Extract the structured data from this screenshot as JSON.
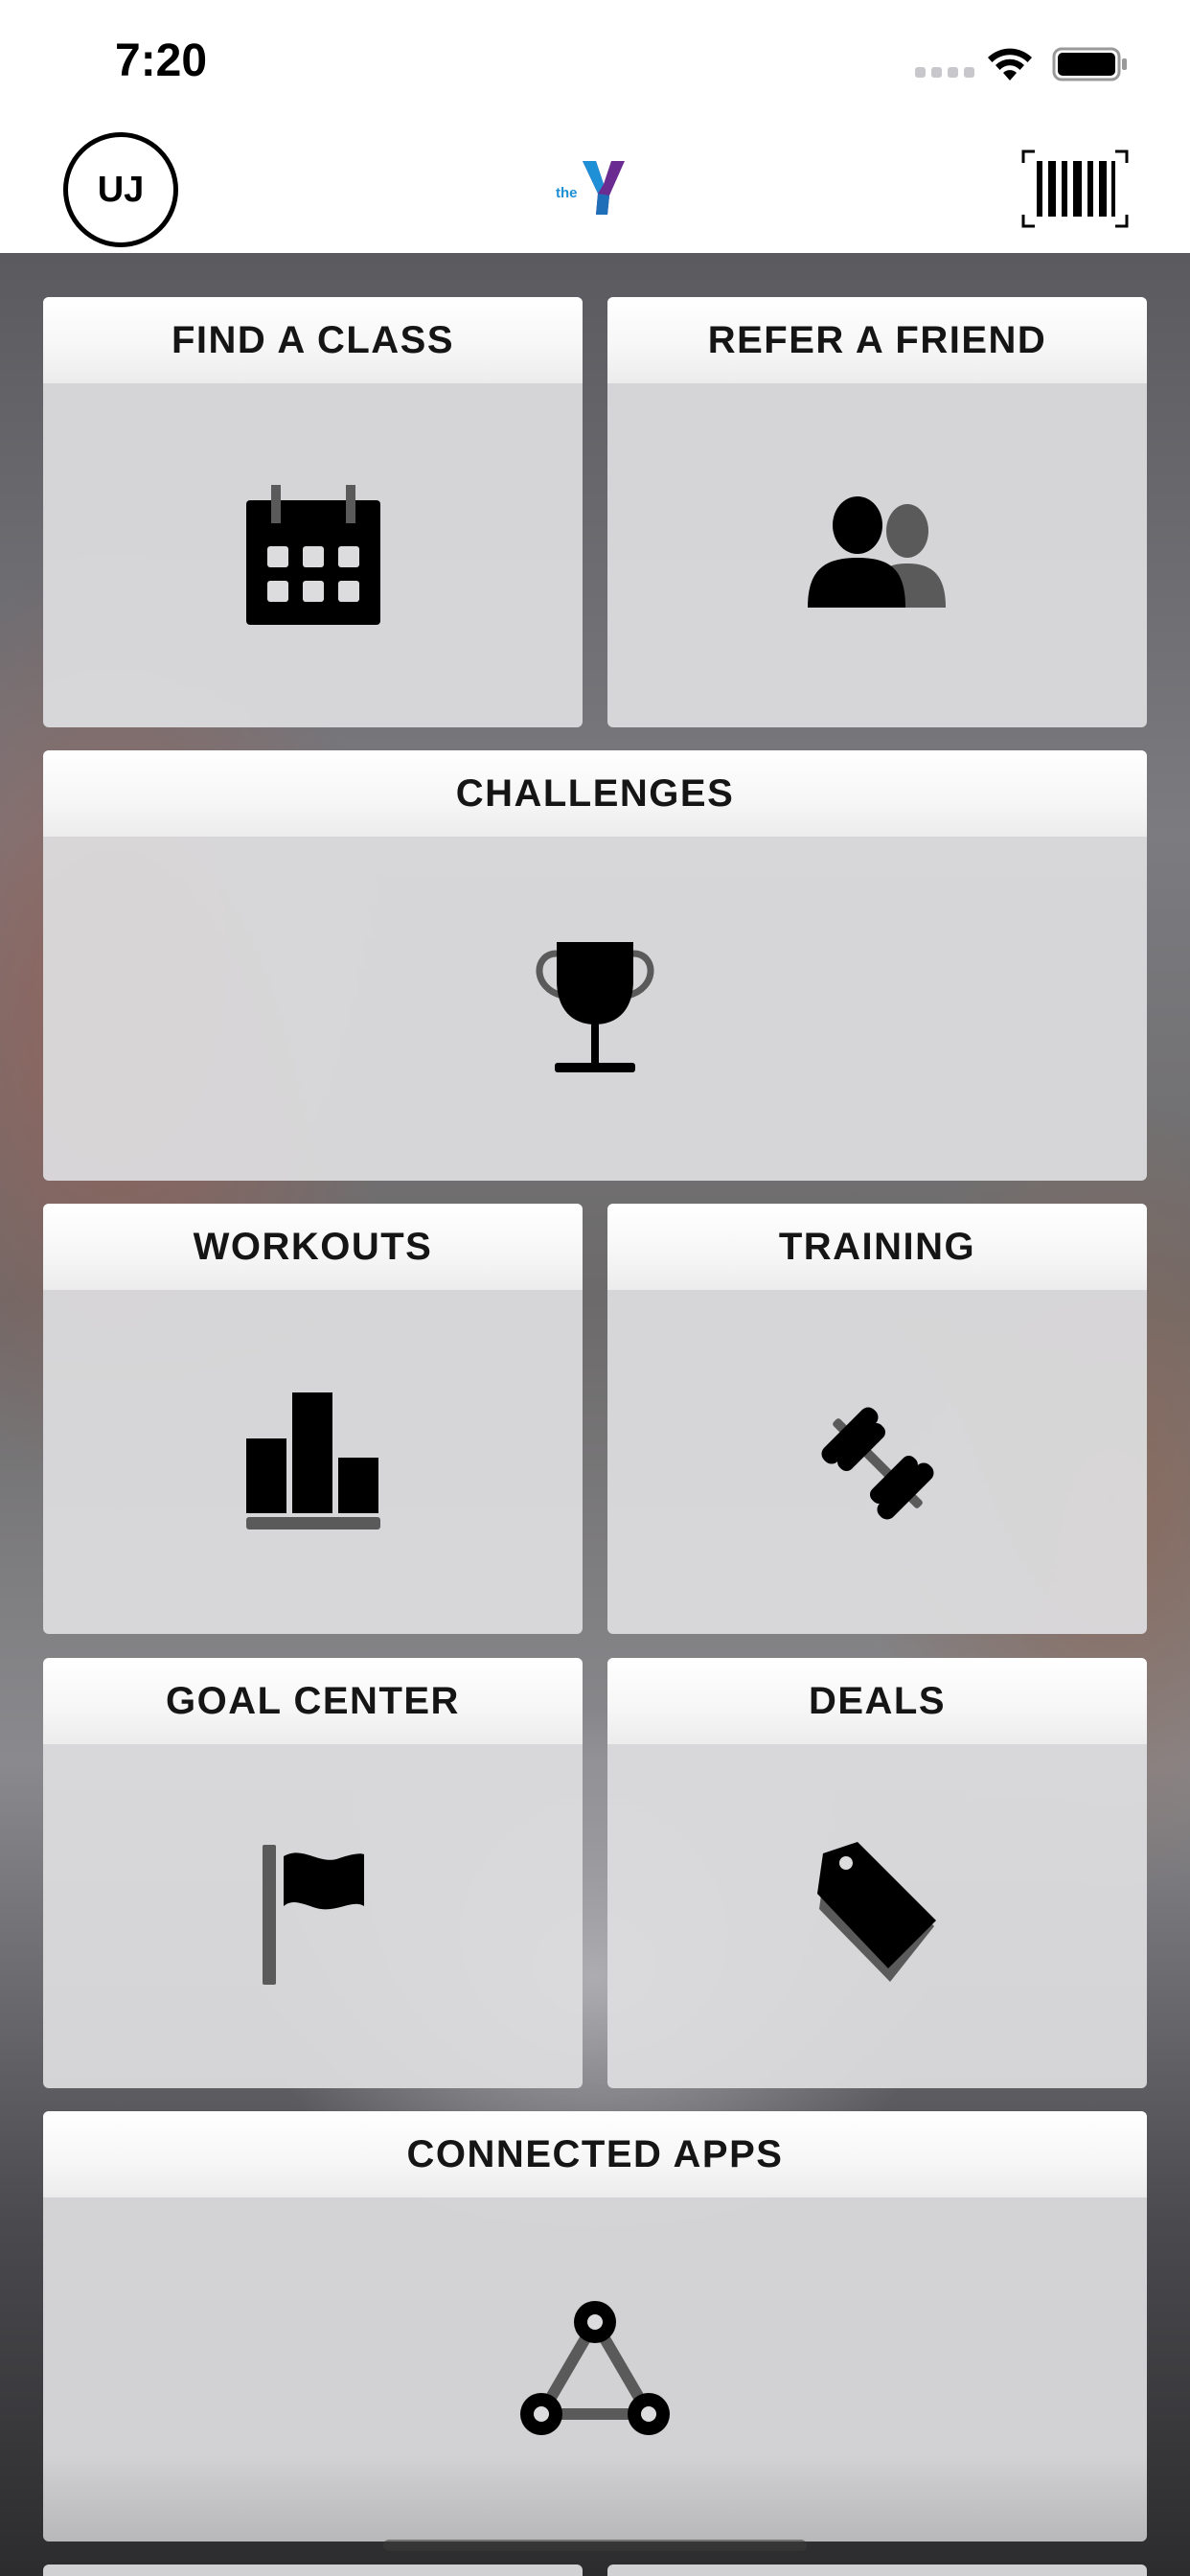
{
  "status_bar": {
    "time": "7:20",
    "wifi_icon": "wifi-icon",
    "battery_icon": "battery-icon"
  },
  "nav": {
    "avatar_initials": "UJ",
    "logo_text": "the",
    "barcode_icon": "barcode-icon"
  },
  "tiles": [
    {
      "label": "FIND A CLASS",
      "icon": "calendar-icon"
    },
    {
      "label": "REFER A FRIEND",
      "icon": "people-icon"
    },
    {
      "label": "CHALLENGES",
      "icon": "trophy-icon"
    },
    {
      "label": "WORKOUTS",
      "icon": "bar-chart-icon"
    },
    {
      "label": "TRAINING",
      "icon": "dumbbell-icon"
    },
    {
      "label": "GOAL CENTER",
      "icon": "flag-icon"
    },
    {
      "label": "DEALS",
      "icon": "tag-icon"
    },
    {
      "label": "CONNECTED APPS",
      "icon": "network-icon"
    }
  ],
  "colors": {
    "icon_primary": "#000000",
    "icon_secondary": "#5a5a5a",
    "logo_blue": "#1f8fd6",
    "logo_purple": "#6b2c91"
  }
}
